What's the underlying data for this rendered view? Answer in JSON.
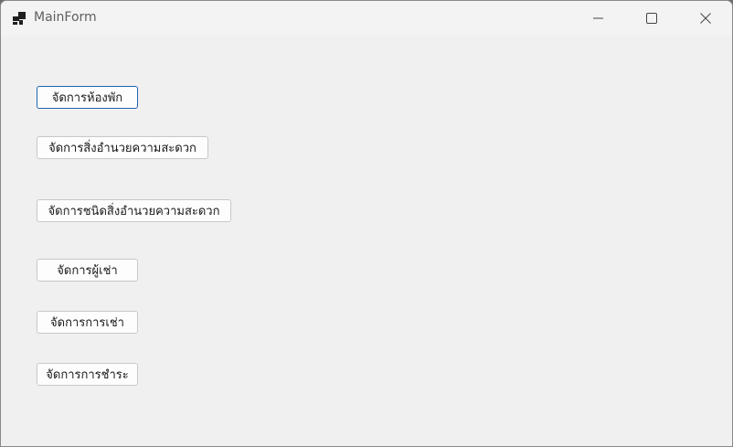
{
  "window": {
    "title": "MainForm"
  },
  "buttons": {
    "rooms": "จัดการห้องพัก",
    "facilities": "จัดการสิ่งอำนวยความสะดวก",
    "facility_types": "จัดการชนิดสิ่งอำนวยความสะดวก",
    "tenants": "จัดการผู้เช่า",
    "rentals": "จัดการการเช่า",
    "payments": "จัดการการชำระ"
  },
  "colors": {
    "focus_border": "#1e64b4",
    "window_bg": "#f0f0f0"
  }
}
